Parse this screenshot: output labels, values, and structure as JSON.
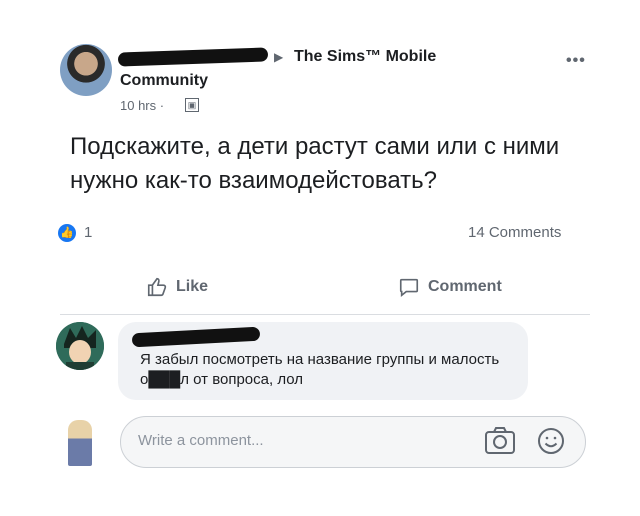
{
  "post": {
    "group_name": "The Sims™ Mobile",
    "community": "Community",
    "timestamp": "10 hrs ·",
    "more": "•••",
    "text": "Подскажите, а дети растут сами или с ними нужно как-то взаимодейстовать?",
    "like_count": "1",
    "comments_count": "14 Comments"
  },
  "actions": {
    "like_label": "Like",
    "comment_label": "Comment"
  },
  "comment": {
    "text": "Я забыл посмотреть на название группы и малость о███л от вопроса, лол"
  },
  "compose": {
    "placeholder": "Write a comment..."
  },
  "colors": {
    "accent": "#1877f2",
    "muted": "#606770",
    "bubble": "#f0f2f5"
  }
}
